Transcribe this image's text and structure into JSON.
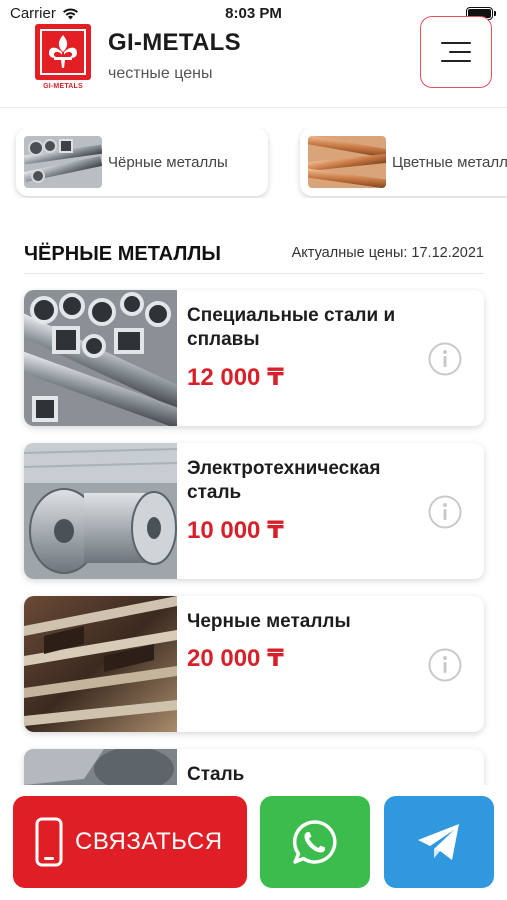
{
  "status_bar": {
    "carrier": "Carrier",
    "time": "8:03 PM"
  },
  "header": {
    "logo_caption": "GI-METALS",
    "brand_title": "GI-METALS",
    "brand_subtitle": "честные цены",
    "menu_icon": "hamburger-menu-icon"
  },
  "categories": [
    {
      "label": "Чёрные металлы",
      "thumb": "steel-pipes-thumbnail"
    },
    {
      "label": "Цветные металлы",
      "thumb": "copper-pipes-thumbnail"
    }
  ],
  "section": {
    "title": "ЧЁРНЫЕ МЕТАЛЛЫ",
    "date_label": "Актуалные цены: 17.12.2021"
  },
  "products": [
    {
      "name": "Специальные стали и сплавы",
      "price": "12 000 ₸",
      "image": "steel-tubes-photo"
    },
    {
      "name": "Электротехническая сталь",
      "price": "10 000 ₸",
      "image": "steel-coils-photo"
    },
    {
      "name": "Черные металлы",
      "price": "20 000 ₸",
      "image": "angle-iron-photo"
    },
    {
      "name": "Сталь",
      "price": "",
      "image": "steel-sheets-photo"
    }
  ],
  "actions": {
    "contact_label": "СВЯЗАТЬСЯ",
    "contact_icon": "phone-icon",
    "whatsapp_icon": "whatsapp-icon",
    "telegram_icon": "telegram-icon"
  },
  "colors": {
    "brand_red": "#e01e26",
    "price_red": "#d8202a",
    "whatsapp_green": "#3cbc4c",
    "telegram_blue": "#2f98de"
  }
}
